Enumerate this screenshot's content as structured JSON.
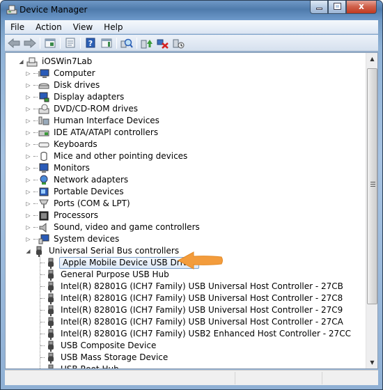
{
  "window": {
    "title": "Device Manager",
    "icon": "device-manager-icon",
    "controls": {
      "minimize": "minimize",
      "maximize": "maximize",
      "close": "x"
    }
  },
  "menu": [
    "File",
    "Action",
    "View",
    "Help"
  ],
  "toolbar": {
    "buttons": [
      {
        "name": "back-button",
        "icon": "arrow-left-icon"
      },
      {
        "name": "forward-button",
        "icon": "arrow-right-icon"
      },
      {
        "name": "show-hide-console-tree-button",
        "icon": "console-tree-icon"
      },
      {
        "name": "properties-button",
        "icon": "properties-icon"
      },
      {
        "name": "help-button",
        "icon": "help-icon"
      },
      {
        "name": "show-action-pane-button",
        "icon": "action-pane-icon"
      },
      {
        "name": "scan-hardware-changes-button",
        "icon": "scan-hardware-icon"
      },
      {
        "name": "update-driver-button",
        "icon": "update-driver-icon"
      },
      {
        "name": "uninstall-button",
        "icon": "uninstall-icon"
      },
      {
        "name": "disable-button",
        "icon": "disable-device-icon"
      }
    ]
  },
  "tree": {
    "root": {
      "label": "iOSWin7Lab",
      "expanded": true
    },
    "categories": [
      {
        "label": "Computer",
        "icon": "computer-icon"
      },
      {
        "label": "Disk drives",
        "icon": "disk-drive-icon"
      },
      {
        "label": "Display adapters",
        "icon": "display-adapter-icon"
      },
      {
        "label": "DVD/CD-ROM drives",
        "icon": "dvd-drive-icon"
      },
      {
        "label": "Human Interface Devices",
        "icon": "hid-icon"
      },
      {
        "label": "IDE ATA/ATAPI controllers",
        "icon": "ide-controller-icon"
      },
      {
        "label": "Keyboards",
        "icon": "keyboard-icon"
      },
      {
        "label": "Mice and other pointing devices",
        "icon": "mouse-icon"
      },
      {
        "label": "Monitors",
        "icon": "monitor-icon"
      },
      {
        "label": "Network adapters",
        "icon": "network-adapter-icon"
      },
      {
        "label": "Portable Devices",
        "icon": "portable-device-icon"
      },
      {
        "label": "Ports (COM & LPT)",
        "icon": "port-icon"
      },
      {
        "label": "Processors",
        "icon": "processor-icon"
      },
      {
        "label": "Sound, video and game controllers",
        "icon": "sound-icon"
      },
      {
        "label": "System devices",
        "icon": "system-devices-icon"
      },
      {
        "label": "Universal Serial Bus controllers",
        "icon": "usb-icon",
        "expanded": true
      }
    ],
    "usb_children": [
      {
        "label": "Apple Mobile Device USB Driver",
        "selected": true
      },
      {
        "label": "General Purpose USB Hub"
      },
      {
        "label": "Intel(R) 82801G (ICH7 Family) USB Universal Host Controller - 27CB"
      },
      {
        "label": "Intel(R) 82801G (ICH7 Family) USB Universal Host Controller - 27C8"
      },
      {
        "label": "Intel(R) 82801G (ICH7 Family) USB Universal Host Controller - 27C9"
      },
      {
        "label": "Intel(R) 82801G (ICH7 Family) USB Universal Host Controller - 27CA"
      },
      {
        "label": "Intel(R) 82801G (ICH7 Family) USB2 Enhanced Host Controller - 27CC"
      },
      {
        "label": "USB Composite Device"
      },
      {
        "label": "USB Mass Storage Device"
      },
      {
        "label": "USB Root Hub"
      }
    ]
  },
  "annotation": {
    "type": "callout-arrow",
    "color": "#f39c3c",
    "points_to": "Apple Mobile Device USB Driver"
  },
  "colors": {
    "selection_border": "#7da2ce",
    "title_bar": "#4f7bac",
    "close_button": "#c03a20"
  }
}
